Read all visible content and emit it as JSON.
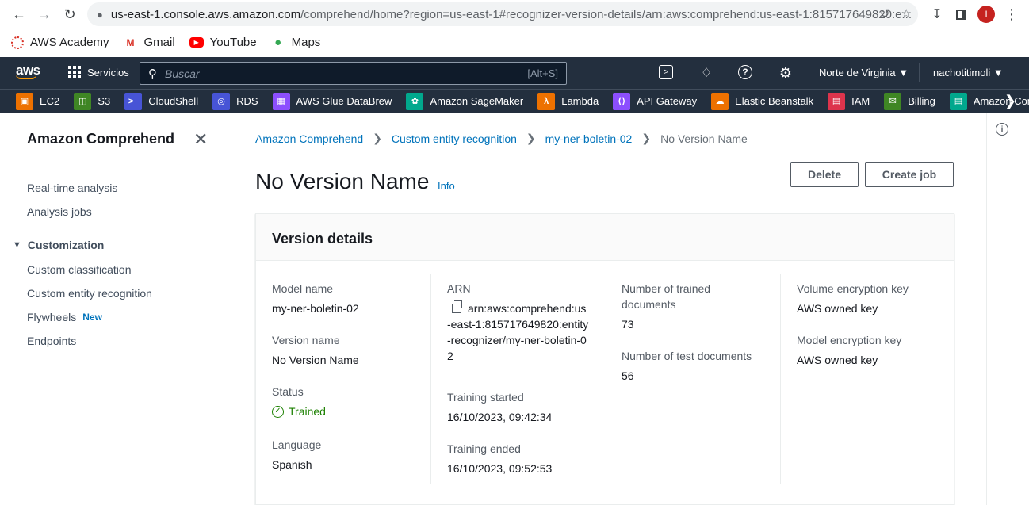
{
  "browser": {
    "url_host": "us-east-1.console.aws.amazon.com",
    "url_path": "/comprehend/home?region=us-east-1#recognizer-version-details/arn:aws:comprehend:us-east-1:815717649820:e...",
    "avatar_letter": "I",
    "bookmarks": [
      {
        "label": "AWS Academy",
        "icon": "aws-academy-icon"
      },
      {
        "label": "Gmail",
        "icon": "gmail-icon"
      },
      {
        "label": "YouTube",
        "icon": "youtube-icon"
      },
      {
        "label": "Maps",
        "icon": "maps-icon"
      }
    ]
  },
  "aws_header": {
    "logo": "aws",
    "services_label": "Servicios",
    "search_placeholder": "Buscar",
    "search_shortcut": "[Alt+S]",
    "region": "Norte de Virginia",
    "user": "nachotitimoli"
  },
  "service_bar": [
    {
      "label": "EC2",
      "color": "#ed7100",
      "glyph": "▣"
    },
    {
      "label": "S3",
      "color": "#3f8624",
      "glyph": "◫"
    },
    {
      "label": "CloudShell",
      "color": "#4754d6",
      "glyph": ">_"
    },
    {
      "label": "RDS",
      "color": "#4754d6",
      "glyph": "◎"
    },
    {
      "label": "AWS Glue DataBrew",
      "color": "#8c4fff",
      "glyph": "▦"
    },
    {
      "label": "Amazon SageMaker",
      "color": "#01a88d",
      "glyph": "✿"
    },
    {
      "label": "Lambda",
      "color": "#ed7100",
      "glyph": "λ"
    },
    {
      "label": "API Gateway",
      "color": "#8c4fff",
      "glyph": "⟨⟩"
    },
    {
      "label": "Elastic Beanstalk",
      "color": "#ed7100",
      "glyph": "☁"
    },
    {
      "label": "IAM",
      "color": "#dd344c",
      "glyph": "▤"
    },
    {
      "label": "Billing",
      "color": "#3f8624",
      "glyph": "✉"
    },
    {
      "label": "Amazon Compreh",
      "color": "#01a88d",
      "glyph": "▤"
    }
  ],
  "leftnav": {
    "title": "Amazon Comprehend",
    "links_top": [
      "Real-time analysis",
      "Analysis jobs"
    ],
    "section": "Customization",
    "section_links": [
      "Custom classification",
      "Custom entity recognition",
      "Flywheels",
      "Endpoints"
    ],
    "new_badge": "New"
  },
  "breadcrumb": [
    "Amazon Comprehend",
    "Custom entity recognition",
    "my-ner-boletin-02",
    "No Version Name"
  ],
  "page": {
    "title": "No Version Name",
    "info": "Info",
    "delete_label": "Delete",
    "create_job_label": "Create job"
  },
  "details": {
    "heading": "Version details",
    "model_name_label": "Model name",
    "model_name": "my-ner-boletin-02",
    "version_name_label": "Version name",
    "version_name": "No Version Name",
    "status_label": "Status",
    "status": "Trained",
    "language_label": "Language",
    "language": "Spanish",
    "arn_label": "ARN",
    "arn": "arn:aws:comprehend:us-east-1:815717649820:entity-recognizer/my-ner-boletin-02",
    "training_started_label": "Training started",
    "training_started": "16/10/2023, 09:42:34",
    "training_ended_label": "Training ended",
    "training_ended": "16/10/2023, 09:52:53",
    "trained_docs_label": "Number of trained documents",
    "trained_docs": "73",
    "test_docs_label": "Number of test documents",
    "test_docs": "56",
    "volume_key_label": "Volume encryption key",
    "volume_key": "AWS owned key",
    "model_key_label": "Model encryption key",
    "model_key": "AWS owned key"
  }
}
